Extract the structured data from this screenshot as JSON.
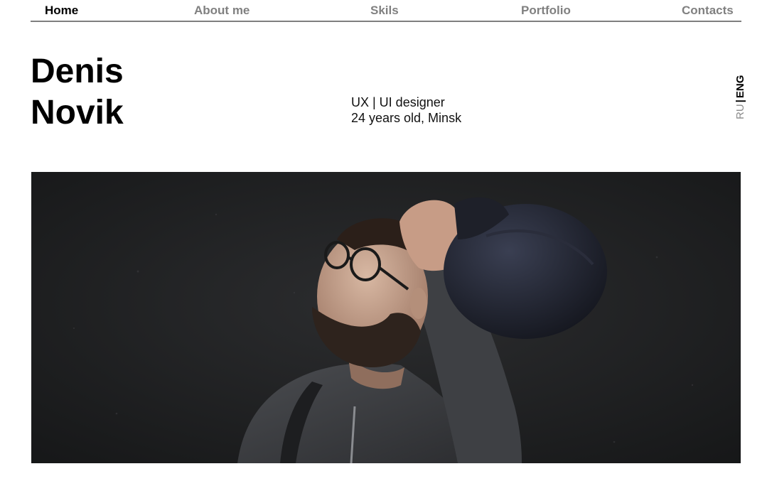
{
  "nav": {
    "items": [
      {
        "label": "Home",
        "active": true
      },
      {
        "label": "About me",
        "active": false
      },
      {
        "label": "Skils",
        "active": false
      },
      {
        "label": "Portfolio",
        "active": false
      },
      {
        "label": "Contacts",
        "active": false
      }
    ]
  },
  "hero": {
    "first_name": "Denis",
    "last_name": "Novik",
    "role": "UX | UI designer",
    "details": "24 years old, Minsk"
  },
  "lang": {
    "ru": "RU",
    "separator": "|",
    "eng": "ENG",
    "active": "ENG"
  },
  "photo": {
    "subject": "portrait of bearded man in glasses holding a cap against a dark wall"
  },
  "colors": {
    "nav_inactive": "#808080",
    "nav_active": "#000000",
    "divider": "#7f7f7f",
    "photo_bg": "#222325"
  }
}
